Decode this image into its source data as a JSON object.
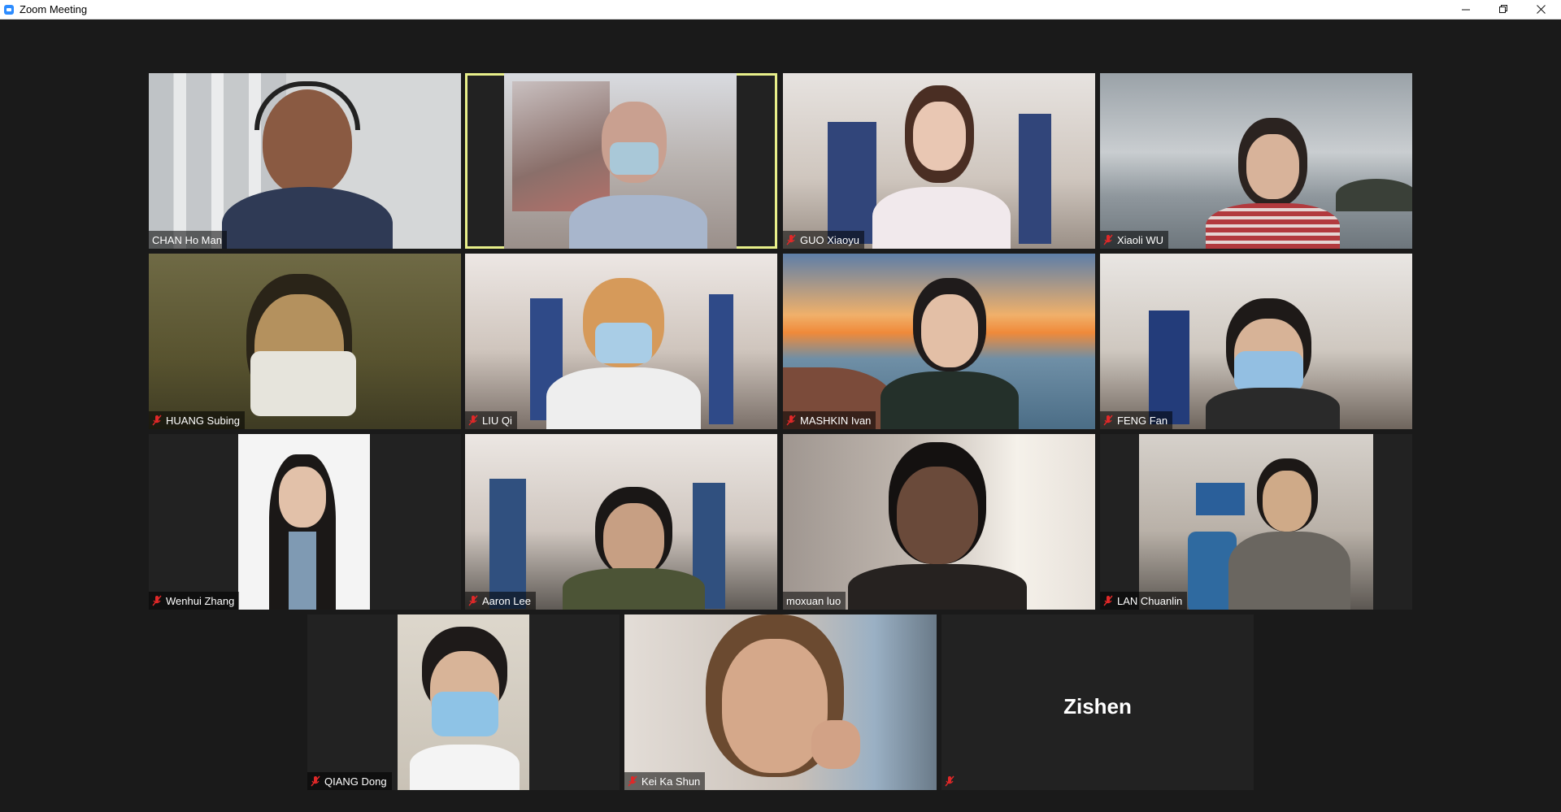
{
  "window": {
    "title": "Zoom Meeting",
    "controls": [
      "minimize",
      "restore",
      "close"
    ]
  },
  "colors": {
    "stage": "#1a1a1a",
    "active_speaker_border": "#e8ef8a",
    "mute_icon": "#e02828"
  },
  "participants": [
    {
      "name": "CHAN Ho Man",
      "muted": false,
      "active_speaker": false
    },
    {
      "name": "",
      "muted": false,
      "active_speaker": true
    },
    {
      "name": "GUO Xiaoyu",
      "muted": true,
      "active_speaker": false
    },
    {
      "name": "Xiaoli WU",
      "muted": true,
      "active_speaker": false
    },
    {
      "name": "HUANG Subing",
      "muted": true,
      "active_speaker": false
    },
    {
      "name": "LIU Qi",
      "muted": true,
      "active_speaker": false
    },
    {
      "name": "MASHKIN Ivan",
      "muted": true,
      "active_speaker": false
    },
    {
      "name": "FENG Fan",
      "muted": true,
      "active_speaker": false
    },
    {
      "name": "Wenhui Zhang",
      "muted": true,
      "active_speaker": false
    },
    {
      "name": "Aaron Lee",
      "muted": true,
      "active_speaker": false
    },
    {
      "name": "moxuan luo",
      "muted": false,
      "active_speaker": false
    },
    {
      "name": "LAN Chuanlin",
      "muted": true,
      "active_speaker": false
    },
    {
      "name": "QIANG Dong",
      "muted": true,
      "active_speaker": false
    },
    {
      "name": "Kei Ka Shun",
      "muted": true,
      "active_speaker": false
    },
    {
      "name": "",
      "muted": true,
      "active_speaker": false,
      "video_off": true,
      "display_name": "Zishen"
    }
  ]
}
